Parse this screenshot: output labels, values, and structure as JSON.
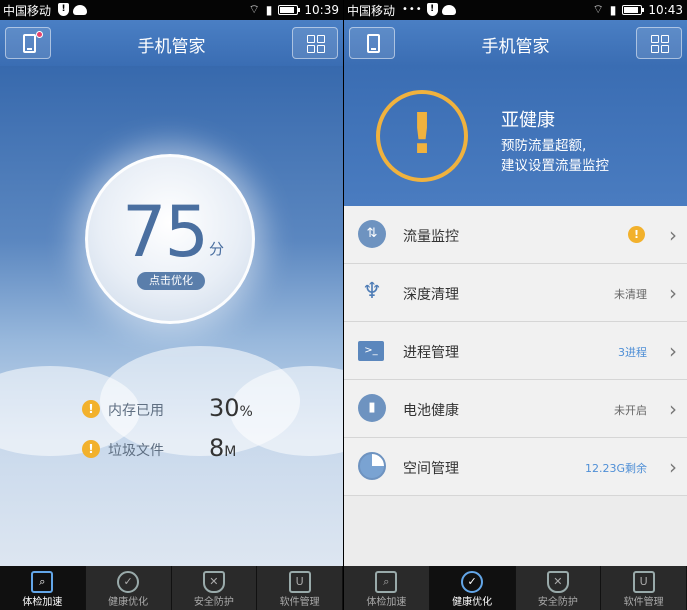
{
  "left": {
    "status": {
      "carrier": "中国移动",
      "time": "10:39"
    },
    "header": {
      "title": "手机管家"
    },
    "score": {
      "value": "75",
      "unit": "分",
      "button": "点击优化"
    },
    "stats": [
      {
        "label": "内存已用",
        "value": "30",
        "unit": "%"
      },
      {
        "label": "垃圾文件",
        "value": "8",
        "unit": "M"
      }
    ],
    "nav": [
      {
        "label": "体检加速",
        "icon": "magnifier-icon"
      },
      {
        "label": "健康优化",
        "icon": "check-circle-icon"
      },
      {
        "label": "安全防护",
        "icon": "shield-icon"
      },
      {
        "label": "软件管理",
        "icon": "bag-icon"
      }
    ],
    "active_nav": 0
  },
  "right": {
    "status": {
      "carrier": "中国移动",
      "time": "10:43"
    },
    "header": {
      "title": "手机管家"
    },
    "health": {
      "title": "亚健康",
      "line1": "预防流量超额,",
      "line2": "建议设置流量监控"
    },
    "items": [
      {
        "label": "流量监控",
        "status": "",
        "icon": "traffic-icon"
      },
      {
        "label": "深度清理",
        "status": "未清理",
        "icon": "broom-icon"
      },
      {
        "label": "进程管理",
        "status": "3进程",
        "icon": "process-icon"
      },
      {
        "label": "电池健康",
        "status": "未开启",
        "icon": "battery-icon"
      },
      {
        "label": "空间管理",
        "status": "12.23G剩余",
        "icon": "storage-pie-icon"
      }
    ],
    "nav": [
      {
        "label": "体检加速"
      },
      {
        "label": "健康优化"
      },
      {
        "label": "安全防护"
      },
      {
        "label": "软件管理"
      }
    ],
    "active_nav": 1
  },
  "colors": {
    "primary_blue": "#3a6db3",
    "warning": "#f2b12c",
    "status_blue": "#4f8fd6"
  }
}
